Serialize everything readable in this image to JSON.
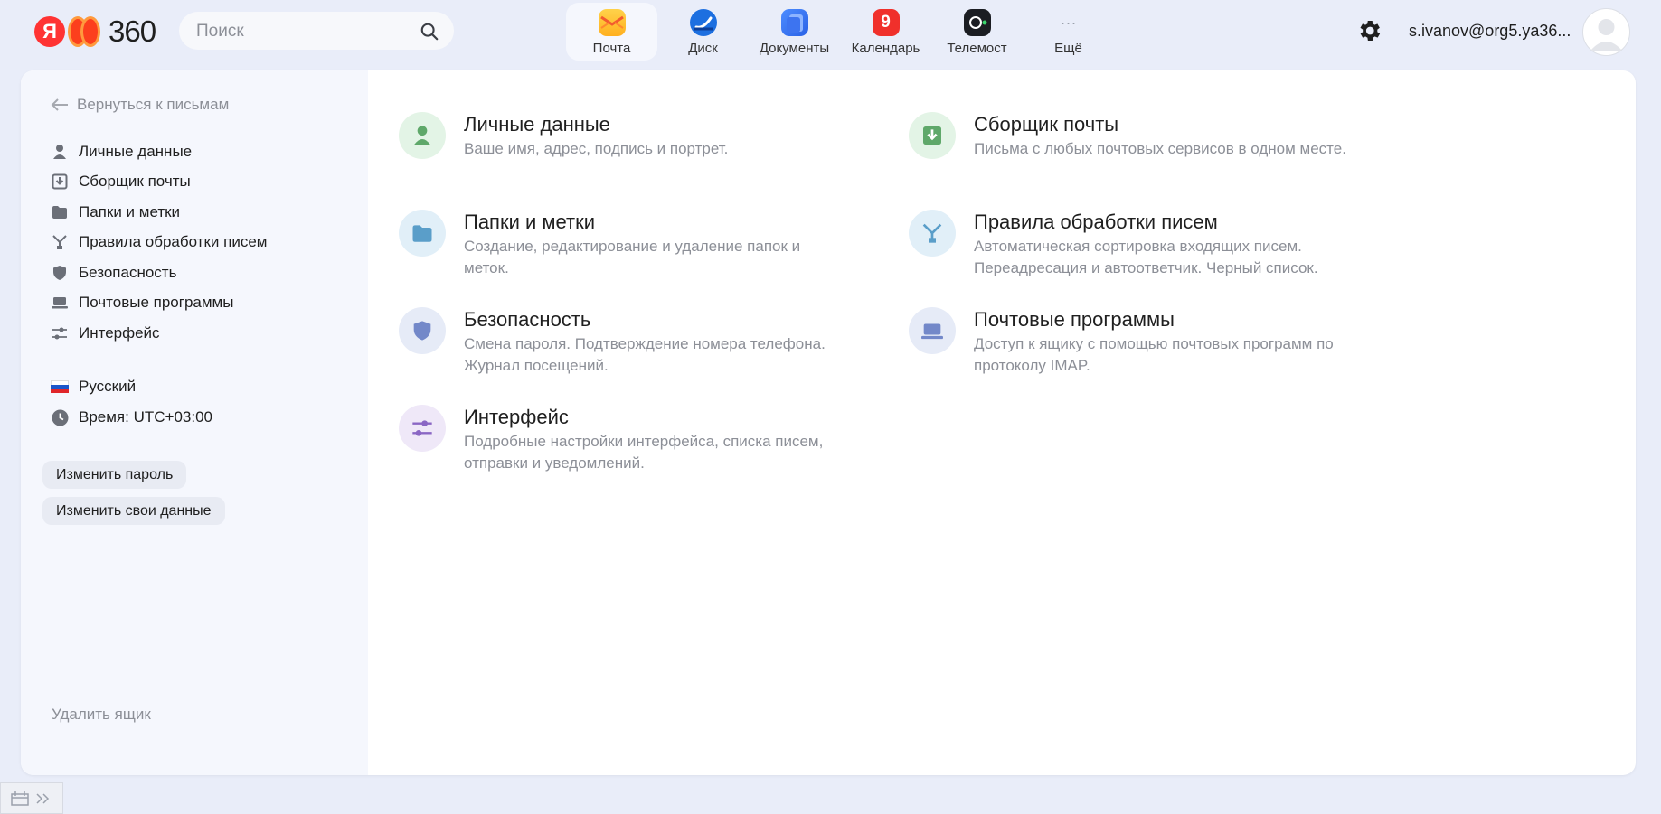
{
  "header": {
    "logo_letter": "Я",
    "logo_number": "360",
    "search_placeholder": "Поиск",
    "apps": [
      {
        "label": "Почта",
        "icon": "mail-icon"
      },
      {
        "label": "Диск",
        "icon": "disk-icon"
      },
      {
        "label": "Документы",
        "icon": "documents-icon"
      },
      {
        "label": "Календарь",
        "icon": "calendar-icon",
        "badge": "9"
      },
      {
        "label": "Телемост",
        "icon": "telemost-icon"
      },
      {
        "label": "Ещё",
        "icon": "more-icon",
        "glyph": "···"
      }
    ],
    "account": "s.ivanov@org5.ya36..."
  },
  "sidebar": {
    "back_label": "Вернуться к письмам",
    "items": [
      {
        "label": "Личные данные",
        "icon": "person-icon"
      },
      {
        "label": "Сборщик почты",
        "icon": "collector-icon"
      },
      {
        "label": "Папки и метки",
        "icon": "folder-icon"
      },
      {
        "label": "Правила обработки писем",
        "icon": "rules-icon"
      },
      {
        "label": "Безопасность",
        "icon": "shield-icon"
      },
      {
        "label": "Почтовые программы",
        "icon": "laptop-icon"
      },
      {
        "label": "Интерфейс",
        "icon": "sliders-icon"
      }
    ],
    "language": "Русский",
    "time": "Время: UTC+03:00",
    "change_password": "Изменить пароль",
    "change_data": "Изменить свои данные",
    "delete_box": "Удалить ящик"
  },
  "tiles": [
    {
      "title": "Личные данные",
      "desc": "Ваше имя, адрес, подпись и портрет.",
      "icon": "person-icon",
      "bg": "#e3f4e6",
      "color": "#5fa86a"
    },
    {
      "title": "Сборщик почты",
      "desc": "Письма с любых почтовых сервисов в одном месте.",
      "icon": "collector-icon",
      "bg": "#e3f4e6",
      "color": "#5fa86a"
    },
    {
      "title": "Папки и метки",
      "desc": "Создание, редактирование и удаление папок и меток.",
      "icon": "folder-icon",
      "bg": "#e1eff8",
      "color": "#5a9ec9"
    },
    {
      "title": "Правила обработки писем",
      "desc": "Автоматическая сортировка входящих писем. Переадресация и автоответчик. Черный список.",
      "icon": "rules-icon",
      "bg": "#e1eff8",
      "color": "#5a9ec9"
    },
    {
      "title": "Безопасность",
      "desc": "Смена пароля. Подтверждение номера телефона. Журнал посещений.",
      "icon": "shield-icon",
      "bg": "#e6ebf7",
      "color": "#7388c9"
    },
    {
      "title": "Почтовые программы",
      "desc": "Доступ к ящику с помощью почтовых программ по протоколу IMAP.",
      "icon": "laptop-icon",
      "bg": "#e6ebf7",
      "color": "#7388c9"
    },
    {
      "title": "Интерфейс",
      "desc": "Подробные настройки интерфейса, списка писем, отправки и уведомлений.",
      "icon": "sliders-icon",
      "bg": "#efe8f8",
      "color": "#8a66c4"
    }
  ]
}
